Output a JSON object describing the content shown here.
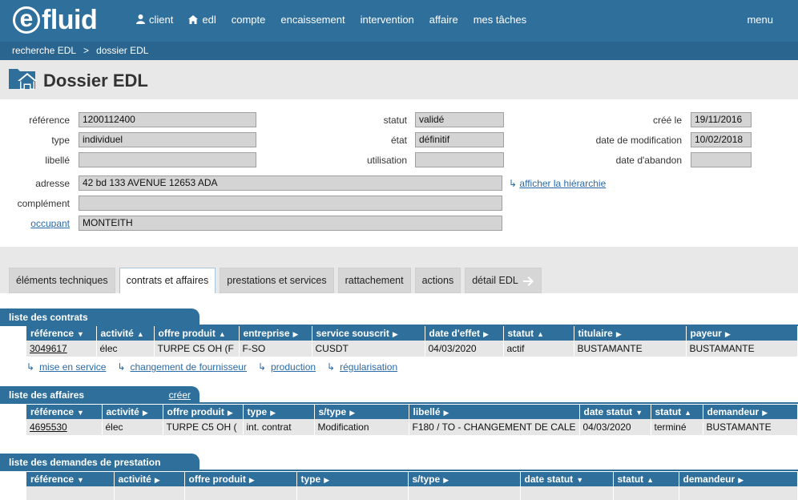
{
  "nav": {
    "logo_e": "e",
    "logo_rest": "fluid",
    "items": [
      "client",
      "edl",
      "compte",
      "encaissement",
      "intervention",
      "affaire",
      "mes tâches"
    ],
    "menu": "menu"
  },
  "breadcrumb": [
    "recherche EDL",
    ">",
    "dossier EDL"
  ],
  "page_title": "Dossier EDL",
  "form": {
    "reference_label": "référence",
    "reference": "1200112400",
    "type_label": "type",
    "type": "individuel",
    "libelle_label": "libellé",
    "libelle": "",
    "statut_label": "statut",
    "statut": "validé",
    "etat_label": "état",
    "etat": "définitif",
    "utilisation_label": "utilisation",
    "utilisation": "",
    "cree_label": "créé le",
    "cree": "19/11/2016",
    "modif_label": "date de modification",
    "modif": "10/02/2018",
    "abandon_label": "date d'abandon",
    "abandon": "",
    "adresse_label": "adresse",
    "adresse": "42 bd 133 AVENUE 12653 ADA",
    "hierarchie_link": "afficher la hiérarchie",
    "complement_label": "complément",
    "complement": "",
    "occupant_label": "occupant",
    "occupant": "MONTEITH"
  },
  "tabs": [
    "éléments techniques",
    "contrats et affaires",
    "prestations et services",
    "rattachement",
    "actions",
    "détail EDL"
  ],
  "contrats": {
    "title": "liste des contrats",
    "columns": [
      "référence",
      "activité",
      "offre produit",
      "entreprise",
      "service souscrit",
      "date d'effet",
      "statut",
      "titulaire",
      "payeur"
    ],
    "row": [
      "3049617",
      "élec",
      "TURPE C5 OH (F",
      "F-SO",
      "CUSDT",
      "04/03/2020",
      "actif",
      "BUSTAMANTE",
      "BUSTAMANTE"
    ],
    "links": [
      "mise en service",
      "changement de fournisseur",
      "production",
      "régularisation"
    ]
  },
  "affaires": {
    "title": "liste des affaires",
    "create": "créer",
    "columns": [
      "référence",
      "activité",
      "offre produit",
      "type",
      "s/type",
      "libellé",
      "date statut",
      "statut",
      "demandeur"
    ],
    "row": [
      "4695530",
      "élec",
      "TURPE C5 OH (",
      "int. contrat",
      "Modification",
      "F180 / TO - CHANGEMENT DE CALE",
      "04/03/2020",
      "terminé",
      "BUSTAMANTE"
    ]
  },
  "demandes": {
    "title": "liste des demandes de prestation",
    "columns": [
      "référence",
      "activité",
      "offre produit",
      "type",
      "s/type",
      "date statut",
      "statut",
      "demandeur"
    ]
  }
}
